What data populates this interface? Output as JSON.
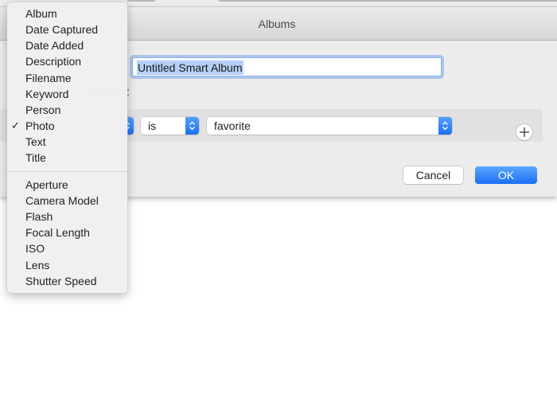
{
  "dialog": {
    "title": "Albums",
    "album_name": "Untitled Smart Album",
    "condition_label": "ondition:",
    "condition": {
      "field_value": "Photo",
      "operator": "is",
      "value": "favorite"
    },
    "add_condition_label": "+",
    "cancel_label": "Cancel",
    "ok_label": "OK"
  },
  "menu": {
    "selected": "Photo",
    "check_glyph": "✓",
    "group1": [
      "Album",
      "Date Captured",
      "Date Added",
      "Description",
      "Filename",
      "Keyword",
      "Person",
      "Photo",
      "Text",
      "Title"
    ],
    "group2": [
      "Aperture",
      "Camera Model",
      "Flash",
      "Focal Length",
      "ISO",
      "Lens",
      "Shutter Speed"
    ]
  },
  "colors": {
    "accent": "#1e6ff4",
    "selection": "#b5d0f6"
  }
}
